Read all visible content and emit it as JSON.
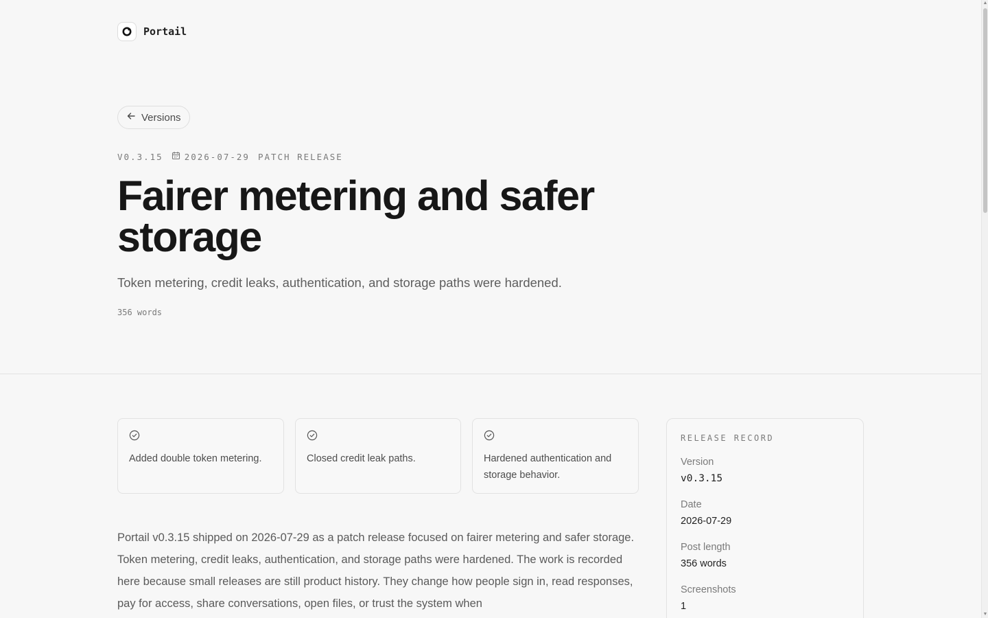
{
  "brand": {
    "name": "Portail"
  },
  "nav": {
    "back_label": "Versions"
  },
  "release": {
    "version_tag": "V0.3.15",
    "date": "2026-07-29",
    "kind": "PATCH RELEASE",
    "title": "Fairer metering and safer storage",
    "subtitle": "Token metering, credit leaks, authentication, and storage paths were hardened.",
    "word_count": "356 words"
  },
  "highlights": [
    {
      "text": "Added double token metering."
    },
    {
      "text": "Closed credit leak paths."
    },
    {
      "text": "Hardened authentication and storage behavior."
    }
  ],
  "body": {
    "paragraph": "Portail v0.3.15 shipped on 2026-07-29 as a patch release focused on fairer metering and safer storage. Token metering, credit leaks, authentication, and storage paths were hardened. The work is recorded here because small releases are still product history. They change how people sign in, read responses, pay for access, share conversations, open files, or trust the system when"
  },
  "record": {
    "title": "RELEASE RECORD",
    "rows": [
      {
        "label": "Version",
        "value": "v0.3.15"
      },
      {
        "label": "Date",
        "value": "2026-07-29"
      },
      {
        "label": "Post length",
        "value": "356 words"
      },
      {
        "label": "Screenshots",
        "value": "1"
      }
    ]
  },
  "icons": {
    "logo": "portail-logo-icon",
    "back": "arrow-left-icon",
    "date": "calendar-icon",
    "highlight": "check-circle-icon"
  }
}
